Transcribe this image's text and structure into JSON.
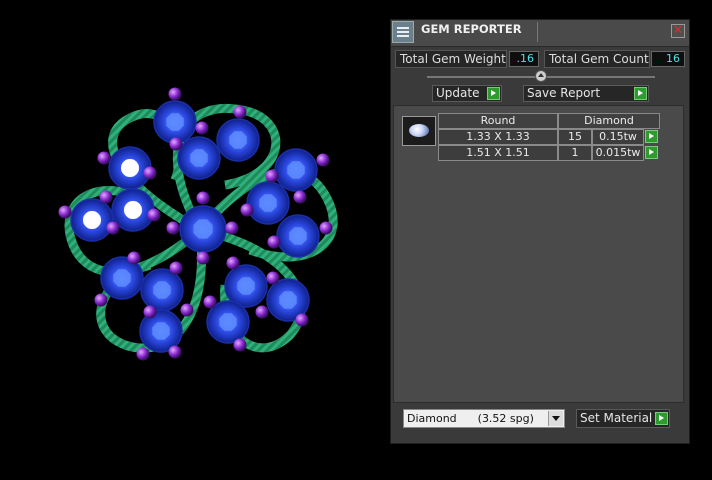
{
  "panel": {
    "title": "GEM REPORTER",
    "total_gem_weight_label": "Total Gem Weight",
    "total_gem_weight_value": ".16",
    "total_gem_count_label": "Total Gem Count",
    "total_gem_count_value": "16",
    "update_label": "Update",
    "save_report_label": "Save Report",
    "table": {
      "headers": [
        "Round",
        "Diamond"
      ],
      "rows": [
        {
          "size": "1.33 X 1.33",
          "count": "15",
          "weight": "0.15tw"
        },
        {
          "size": "1.51 X 1.51",
          "count": "1",
          "weight": "0.015tw"
        }
      ]
    },
    "material_select": "Diamond      (3.52 spg)",
    "set_material_label": "Set Material"
  },
  "colors": {
    "stone": "#2240d8",
    "prong": "#8a2bd0",
    "metal": "#1f8a5c",
    "accent_value": "#4fe0e6"
  },
  "icons": {
    "app": "gem-reporter-icon",
    "close": "close-icon",
    "play": "play-arrow-icon",
    "dropdown": "chevron-down-icon"
  }
}
